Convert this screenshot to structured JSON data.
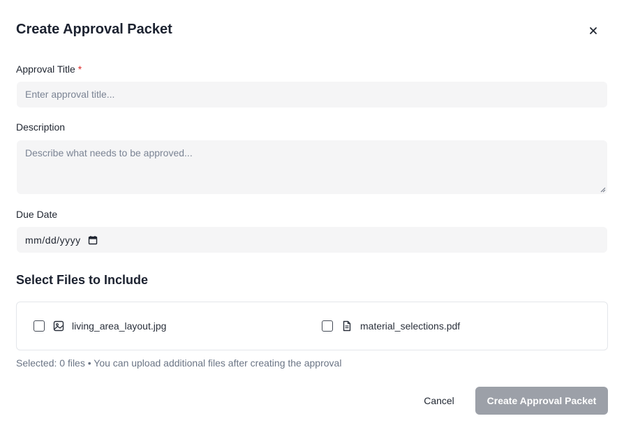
{
  "dialog": {
    "title": "Create Approval Packet",
    "close_icon": "close-icon"
  },
  "form": {
    "approval_title": {
      "label": "Approval Title",
      "required_mark": "*",
      "placeholder": "Enter approval title...",
      "value": ""
    },
    "description": {
      "label": "Description",
      "placeholder": "Describe what needs to be approved...",
      "value": ""
    },
    "due_date": {
      "label": "Due Date",
      "placeholder": "mm/dd/yyyy",
      "icon": "calendar-icon"
    }
  },
  "files": {
    "section_title": "Select Files to Include",
    "items": [
      {
        "name": "living_area_layout.jpg",
        "icon": "image-icon",
        "checked": false
      },
      {
        "name": "material_selections.pdf",
        "icon": "document-icon",
        "checked": false
      }
    ],
    "status_text": "Selected: 0 files • You can upload additional files after creating the approval"
  },
  "actions": {
    "cancel_label": "Cancel",
    "create_label": "Create Approval Packet"
  },
  "colors": {
    "required": "#dc2626",
    "primary_disabled": "#9ca0a8",
    "field_bg": "#f5f5f6"
  }
}
